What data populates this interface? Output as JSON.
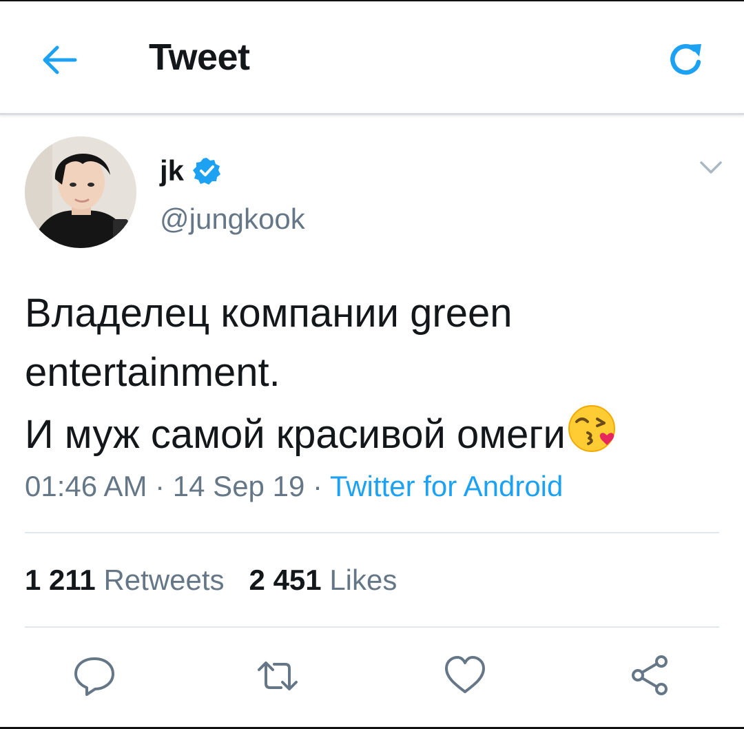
{
  "header": {
    "title": "Tweet",
    "back_icon": "arrow-left-icon",
    "refresh_icon": "refresh-icon"
  },
  "tweet": {
    "author": {
      "name": "jk",
      "handle": "@jungkook",
      "verified": true,
      "avatar": "profile-photo"
    },
    "text_lines": [
      "Владелец компании green",
      "entertainment.",
      "И муж самой красивой омеги"
    ],
    "emoji": "face-blowing-kiss",
    "time": "01:46 AM",
    "separator": " · ",
    "date": "14 Sep 19",
    "source": "Twitter for Android"
  },
  "stats": {
    "retweets_count": "1 211",
    "retweets_label": "Retweets",
    "likes_count": "2 451",
    "likes_label": "Likes"
  },
  "actions": [
    "reply-icon",
    "retweet-icon",
    "like-icon",
    "share-icon"
  ],
  "colors": {
    "accent": "#1da1f2",
    "text": "#14171a",
    "secondary": "#657786",
    "divider": "#e1e8ed"
  }
}
